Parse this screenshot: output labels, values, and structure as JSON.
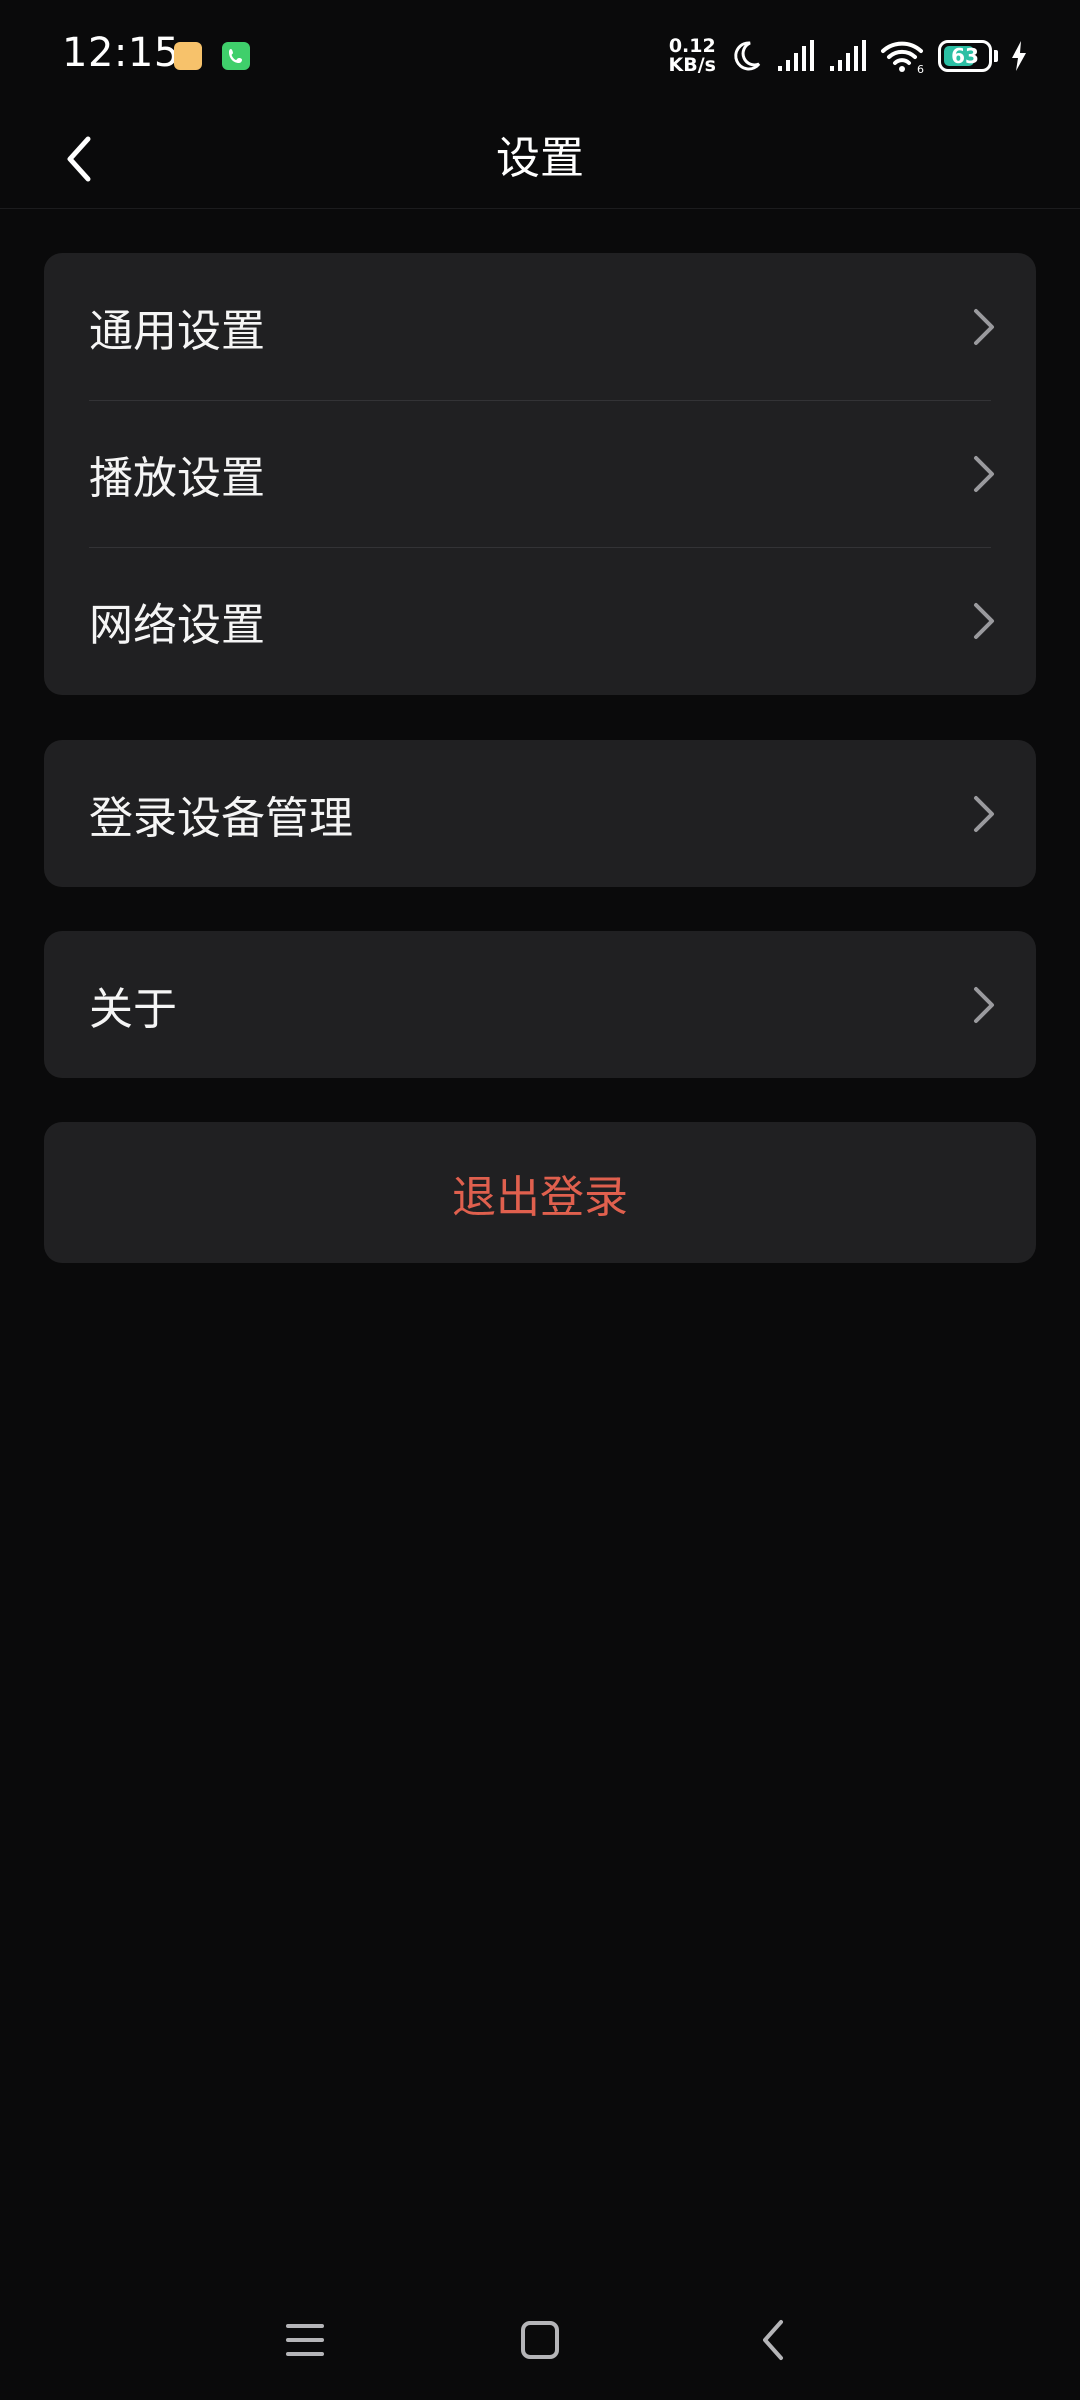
{
  "status_bar": {
    "time": "12:15",
    "net_speed_value": "0.12",
    "net_speed_unit": "KB/s",
    "battery_level": "63",
    "wifi_label": "6",
    "notification_colors": [
      "#f7c26b",
      "#3fcf6b"
    ]
  },
  "header": {
    "title": "设置"
  },
  "menu": {
    "group1": [
      {
        "label": "通用设置"
      },
      {
        "label": "播放设置"
      },
      {
        "label": "网络设置"
      }
    ],
    "group2": [
      {
        "label": "登录设备管理"
      }
    ],
    "group3": [
      {
        "label": "关于"
      }
    ],
    "logout_label": "退出登录"
  },
  "colors": {
    "background": "#0a0a0b",
    "card": "#202022",
    "logout": "#e0604e",
    "battery_fill": "#2bbfa4"
  },
  "icons": {
    "back": "chevron-left-icon",
    "row_arrow": "chevron-right-icon",
    "nav_menu": "menu-icon",
    "nav_home": "home-icon",
    "nav_back": "back-icon"
  }
}
